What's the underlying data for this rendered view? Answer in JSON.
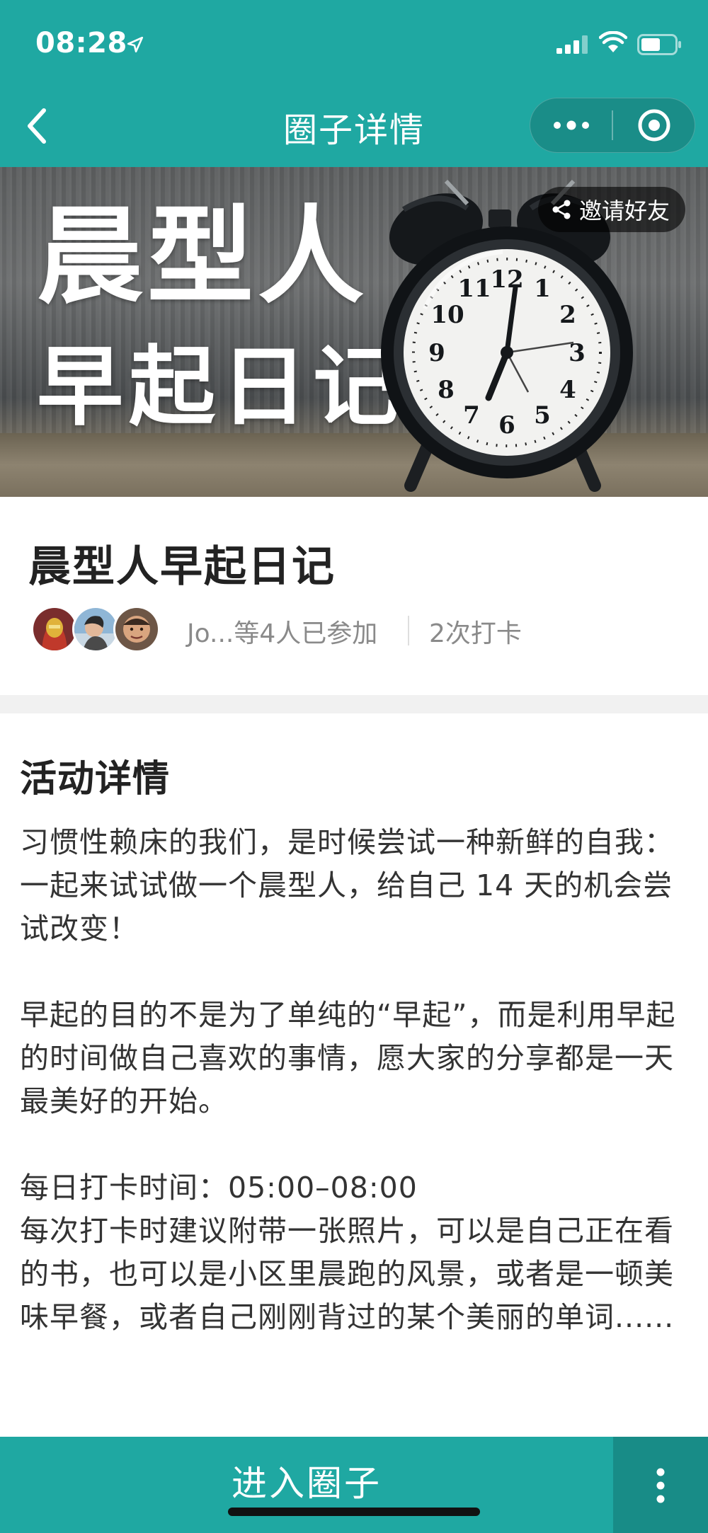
{
  "status_bar": {
    "time": "08:28",
    "icons": [
      "location-arrow-icon",
      "signal-icon",
      "wifi-icon",
      "battery-icon"
    ]
  },
  "nav": {
    "title": "圈子详情",
    "back_icon": "chevron-left-icon",
    "capsule_icons": [
      "more-dots-icon",
      "close-circle-icon"
    ]
  },
  "banner": {
    "line1": "晨型人",
    "line2": "早起日记",
    "invite_label": "邀请好友",
    "invite_icon": "share-icon",
    "clock_numbers": [
      "12",
      "1",
      "2",
      "3",
      "4",
      "5",
      "6",
      "7",
      "8",
      "9",
      "10",
      "11"
    ]
  },
  "circle": {
    "title": "晨型人早起日记",
    "members_text": "Jo...等4人已参加",
    "checkin_text": "2次打卡",
    "avatar_count": 3
  },
  "detail": {
    "heading": "活动详情",
    "para1": "习惯性赖床的我们，是时候尝试一种新鲜的自我：一起来试试做一个晨型人，给自己 14 天的机会尝试改变！",
    "para2": "早起的目的不是为了单纯的“早起”，而是利用早起的时间做自己喜欢的事情，愿大家的分享都是一天最美好的开始。",
    "para3": "每日打卡时间：05:00–08:00",
    "para4": "每次打卡时建议附带一张照片，可以是自己正在看的书，也可以是小区里晨跑的风景，或者是一顿美味早餐，或者自己刚刚背过的某个美丽的单词......"
  },
  "bottom": {
    "enter_label": "进入圈子",
    "more_icon": "vertical-dots-icon"
  },
  "colors": {
    "brand_teal": "#1fa8a2",
    "brand_teal_dark": "#188c87",
    "gray_text": "#8a8a8a"
  }
}
